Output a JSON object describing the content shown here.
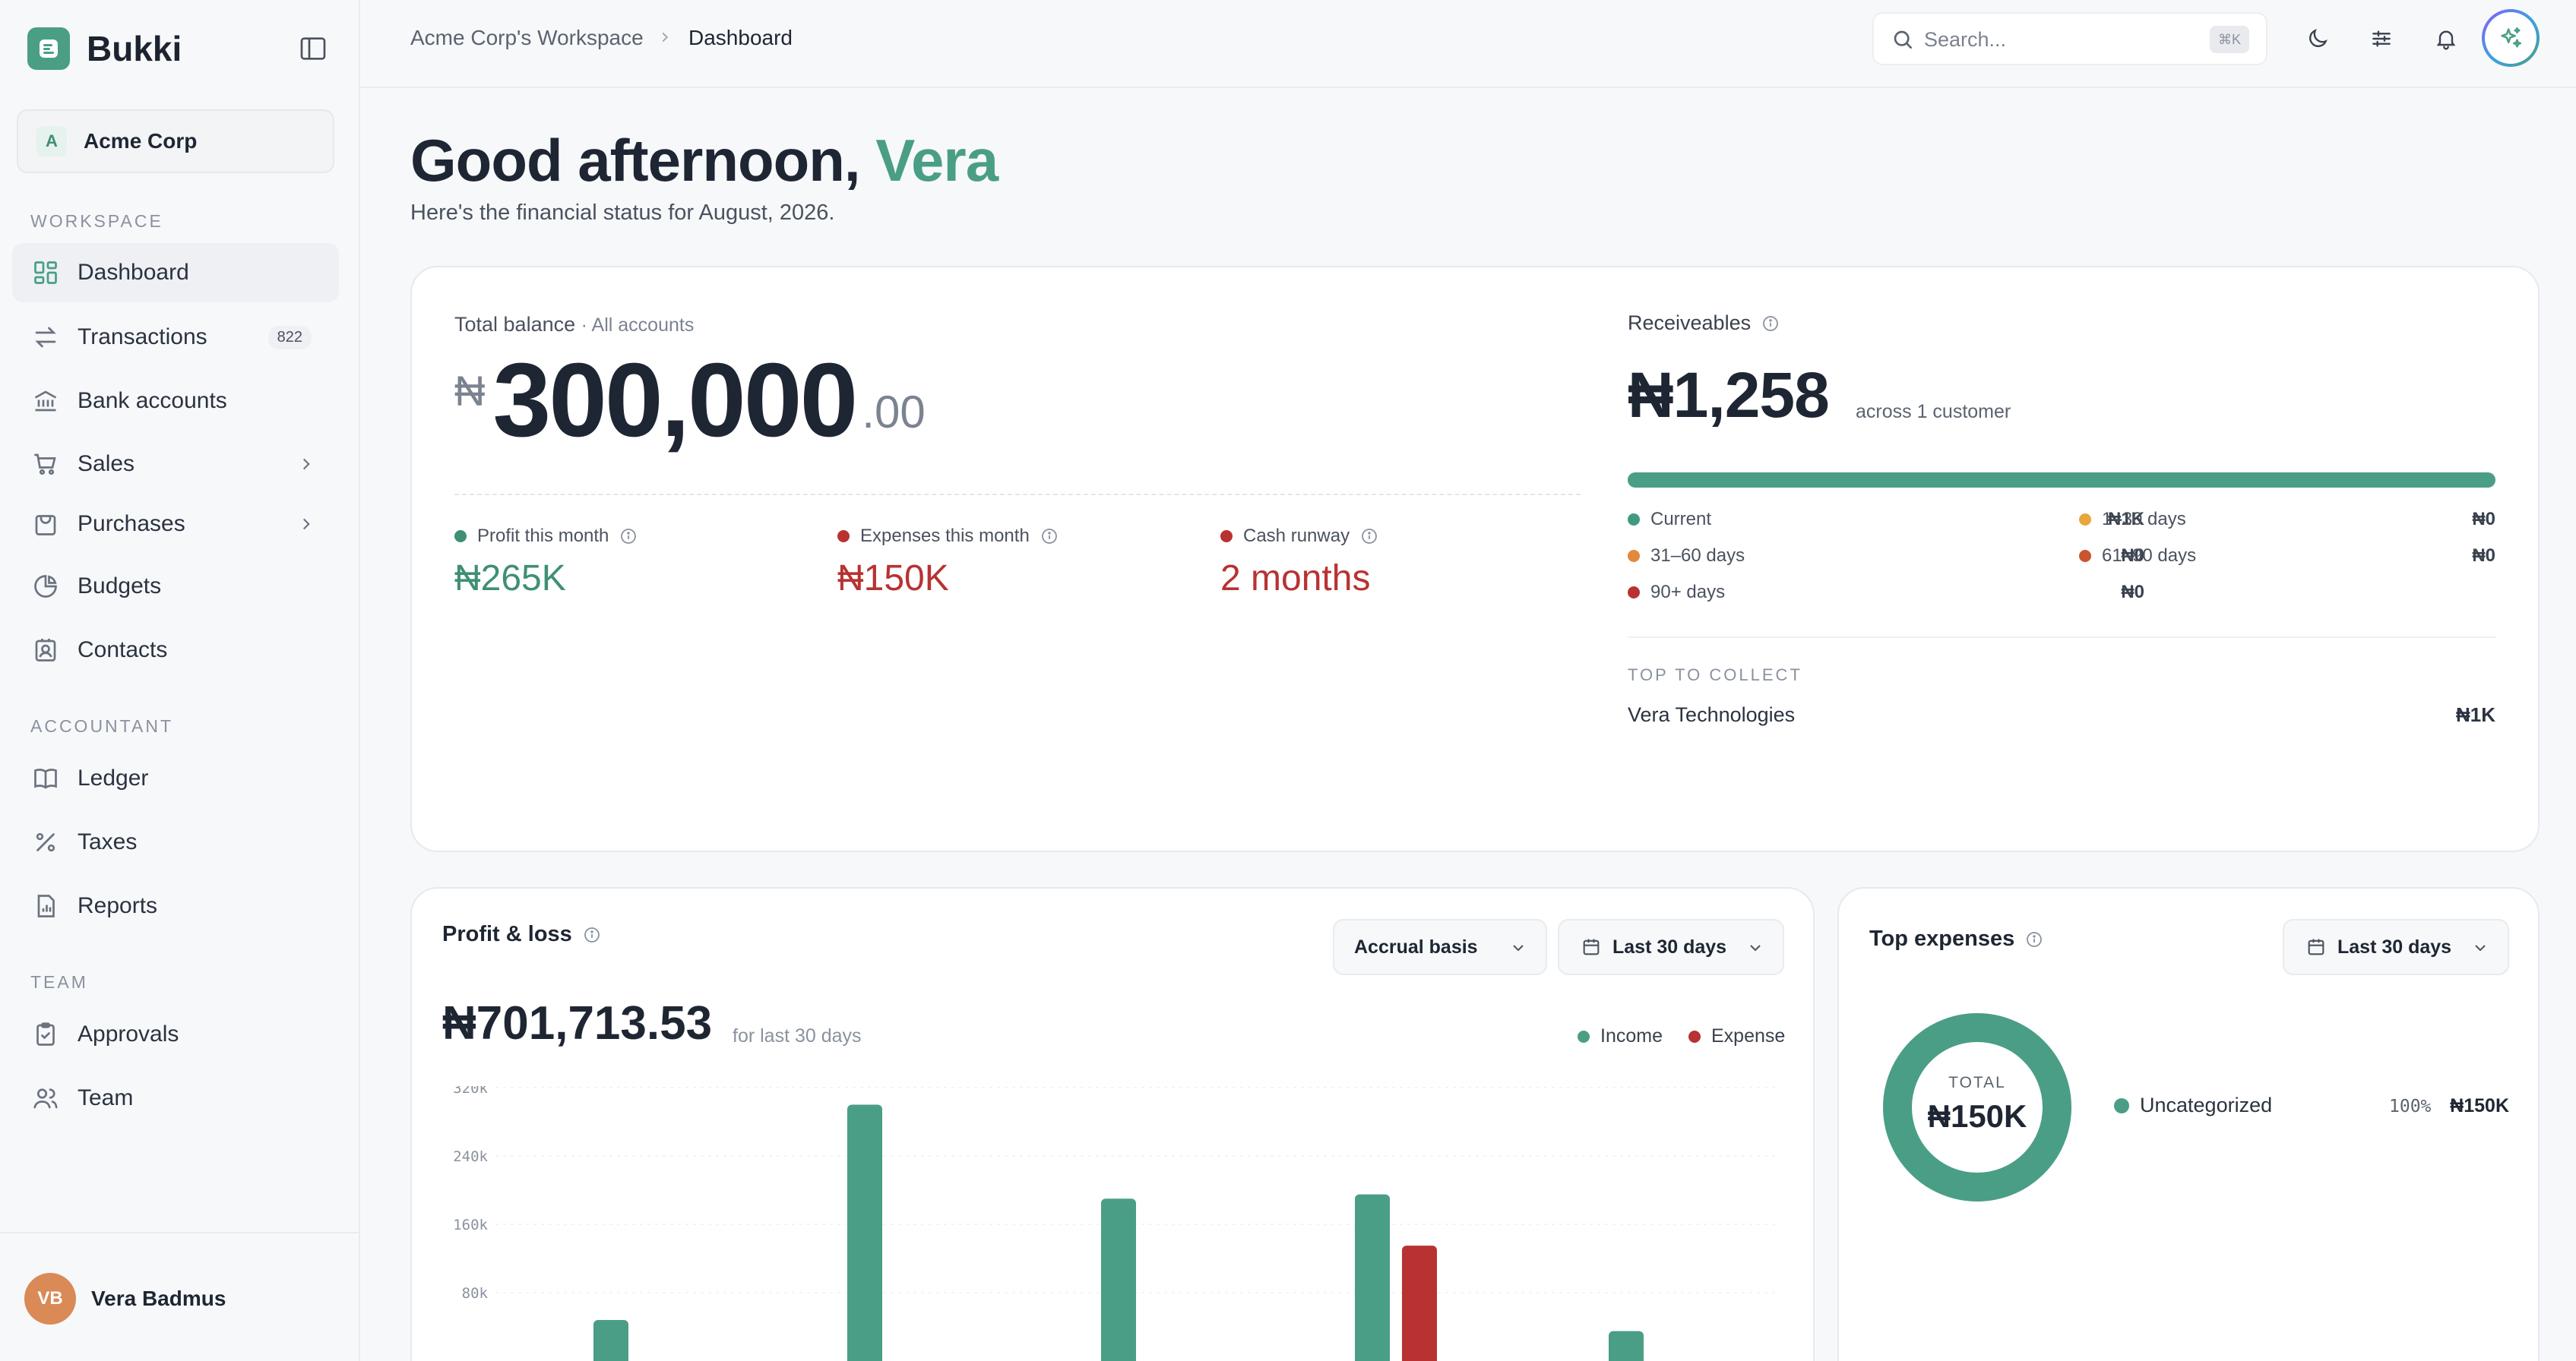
{
  "brand": {
    "name": "Bukki"
  },
  "org": {
    "badge": "A",
    "name": "Acme Corp"
  },
  "sidebar": {
    "sections": [
      "WORKSPACE",
      "ACCOUNTANT",
      "TEAM"
    ],
    "items": [
      {
        "label": "Dashboard",
        "icon": "dashboard-icon",
        "active": true
      },
      {
        "label": "Transactions",
        "icon": "transactions-icon",
        "count": "822"
      },
      {
        "label": "Bank accounts",
        "icon": "bank-icon"
      },
      {
        "label": "Sales",
        "icon": "cart-icon",
        "expandable": true
      },
      {
        "label": "Purchases",
        "icon": "bag-icon",
        "expandable": true
      },
      {
        "label": "Budgets",
        "icon": "pie-icon"
      },
      {
        "label": "Contacts",
        "icon": "contacts-icon"
      },
      {
        "label": "Ledger",
        "icon": "book-icon"
      },
      {
        "label": "Taxes",
        "icon": "percent-icon"
      },
      {
        "label": "Reports",
        "icon": "report-icon"
      },
      {
        "label": "Approvals",
        "icon": "clipboard-icon"
      },
      {
        "label": "Team",
        "icon": "users-icon"
      }
    ]
  },
  "user": {
    "initials": "VB",
    "name": "Vera Badmus"
  },
  "topbar": {
    "breadcrumb": [
      "Acme Corp's Workspace",
      "Dashboard"
    ],
    "search_placeholder": "Search...",
    "search_shortcut": "⌘K"
  },
  "greeting": {
    "prefix": "Good afternoon,",
    "name": "Vera",
    "subtitle": "Here's the financial status for August, 2026."
  },
  "balance": {
    "label": "Total balance",
    "scope": "· All accounts",
    "currency": "₦",
    "amount": "300,000",
    "decimals": ".00",
    "kpis": [
      {
        "label": "Profit this month",
        "value": "₦265K",
        "color": "#3f8f76"
      },
      {
        "label": "Expenses this month",
        "value": "₦150K",
        "color": "#b83232"
      },
      {
        "label": "Cash runway",
        "value": "2 months",
        "color": "#b83232"
      }
    ]
  },
  "receivables": {
    "title": "Receiveables",
    "amount": "₦1,258",
    "note": "across 1 customer",
    "current_fraction": 1.0,
    "aging": [
      {
        "label": "Current",
        "value": "₦1K",
        "color": "#3f9a80"
      },
      {
        "label": "1–30 days",
        "value": "₦0",
        "color": "#e6a83a"
      },
      {
        "label": "31–60 days",
        "value": "₦0",
        "color": "#e08a3c"
      },
      {
        "label": "61–90 days",
        "value": "₦0",
        "color": "#c9542e"
      },
      {
        "label": "90+ days",
        "value": "₦0",
        "color": "#b83232"
      }
    ],
    "top_label": "TOP TO COLLECT",
    "top_customer": "Vera Technologies",
    "top_amount": "₦1K"
  },
  "pnl": {
    "title": "Profit & loss",
    "basis": "Accrual basis",
    "range": "Last 30 days",
    "amount": "₦701,713.53",
    "note": "for last 30 days",
    "legend": [
      {
        "label": "Income",
        "color": "#4a9e86"
      },
      {
        "label": "Expense",
        "color": "#b83232"
      }
    ]
  },
  "chart_data": {
    "type": "bar",
    "y_ticks": [
      "320k",
      "240k",
      "160k",
      "80k"
    ],
    "ylim": [
      0,
      320000
    ],
    "series": [
      {
        "name": "Income",
        "color": "#4a9e86",
        "values": [
          48000,
          300000,
          190000,
          195000,
          35000
        ]
      },
      {
        "name": "Expense",
        "color": "#b83232",
        "values": [
          0,
          0,
          0,
          135000,
          0
        ]
      }
    ]
  },
  "top_expenses": {
    "title": "Top expenses",
    "range": "Last 30 days",
    "total_label": "TOTAL",
    "total": "₦150K",
    "items": [
      {
        "label": "Uncategorized",
        "pct": "100%",
        "amount": "₦150K",
        "color": "#4a9e86"
      }
    ]
  }
}
